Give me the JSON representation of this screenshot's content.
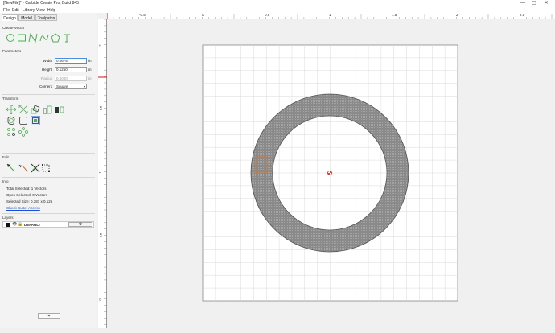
{
  "window": {
    "title": "[NewFile]* - Carbide Create Pro, Build 845",
    "controls": {
      "minimize": "—",
      "maximize": "▢",
      "close": "✕"
    }
  },
  "menu": [
    "File",
    "Edit",
    "Library",
    "View",
    "Help"
  ],
  "tabs": [
    "Design",
    "Model",
    "Toolpaths"
  ],
  "sections": {
    "create_vector": "Create Vector",
    "parameters": "Parameters",
    "transform": "Transform",
    "edit": "Edit",
    "info": "Info",
    "layers": "Layers"
  },
  "create_vector_icons": [
    "circle-icon",
    "rectangle-icon",
    "polyline-icon",
    "curve-icon",
    "polygon-icon",
    "text-icon"
  ],
  "parameters": {
    "width_label": "Width",
    "width_value": "0.0675",
    "height_label": "Height",
    "height_value": "0.1250",
    "radius_label": "Radius",
    "radius_value": "0.0000",
    "corners_label": "Corners",
    "corners_value": "Square",
    "unit": "in"
  },
  "info": {
    "total_selected": "Total Selected:   1 Vectors",
    "open_selected": "Open Selected:   0 Vectors",
    "selected_size": "Selected Size:    0.387 x 0.125",
    "check_cutter_access": "Check Cutter Access"
  },
  "layers": {
    "default_name": "DEFAULT",
    "add_button": "+"
  },
  "rulers": {
    "horizontal_ticks": [
      "-0.5",
      "0",
      "0.5",
      "1",
      "1.5",
      "2",
      "2.5"
    ],
    "vertical_ticks": [
      "2",
      "1.5",
      "1",
      "0.5",
      "0"
    ]
  },
  "colors": {
    "vector_green": "#4caf50",
    "ring_fill": "#8c8c8c",
    "selection_orange": "#e07020",
    "ruler_red": "#e53935",
    "link_blue": "#1a4fd6"
  }
}
